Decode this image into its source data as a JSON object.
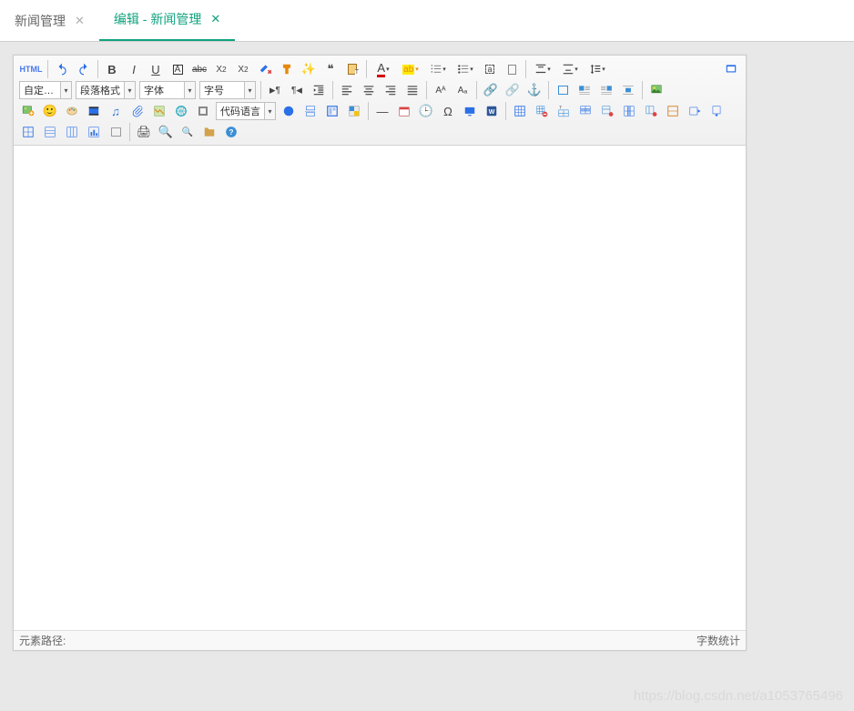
{
  "tabs": [
    {
      "label": "新闻管理",
      "active": false
    },
    {
      "label": "编辑 - 新闻管理",
      "active": true
    }
  ],
  "toolbar": {
    "html_label": "HTML",
    "combos": {
      "style": "自定义标题",
      "paragraph": "段落格式",
      "font": "字体",
      "size": "字号",
      "code_lang": "代码语言"
    },
    "letters": {
      "bold": "B",
      "italic": "I",
      "underline": "U",
      "strike": "abc",
      "font_a": "A",
      "sub_a": "a",
      "quote": "❝",
      "pilcrow": "¶",
      "omega": "Ω"
    }
  },
  "statusbar": {
    "path": "元素路径:",
    "wordcount": "字数统计"
  },
  "watermark": "https://blog.csdn.net/a1053765496"
}
